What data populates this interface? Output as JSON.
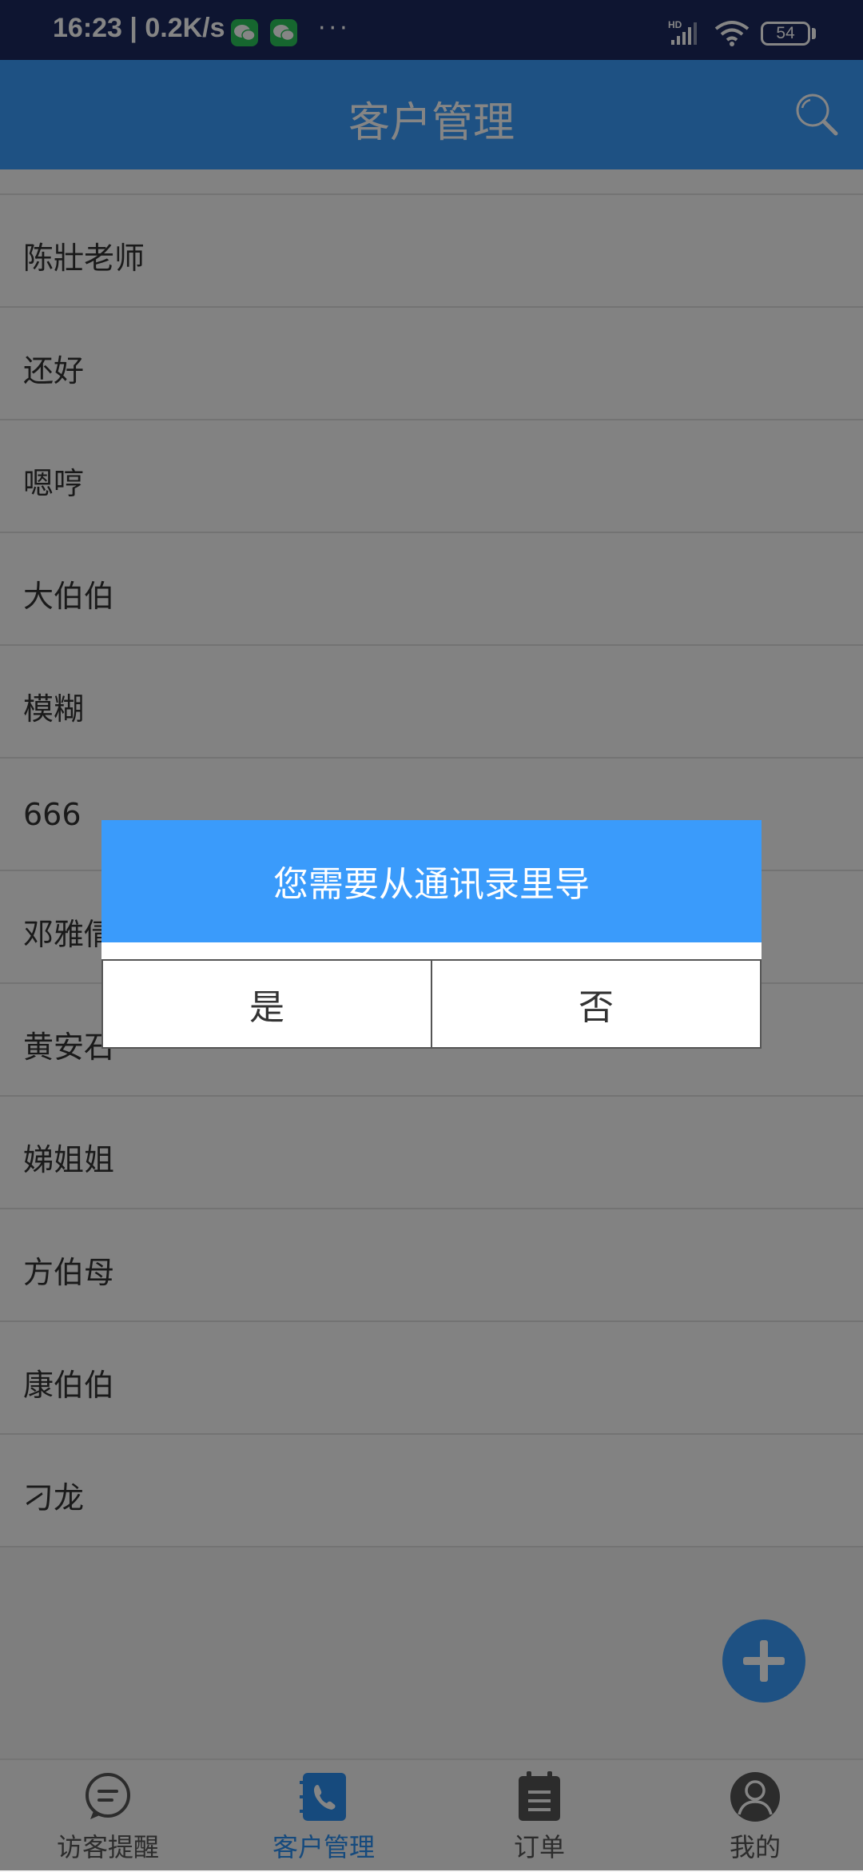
{
  "status_bar": {
    "time_speed": "16:23 | 0.2K/s",
    "dots": "···",
    "network_label": "HD",
    "battery": "54"
  },
  "header": {
    "title": "客户管理"
  },
  "customers": [
    "陈壯老师",
    "还好",
    "嗯哼",
    "大伯伯",
    "模糊",
    "666",
    "邓雅倩",
    "黄安石",
    "娣姐姐",
    "方伯母",
    "康伯伯",
    "刁龙"
  ],
  "bottom_nav": {
    "items": [
      {
        "label": "访客提醒",
        "icon": "chat-icon"
      },
      {
        "label": "客户管理",
        "icon": "phone-book-icon",
        "active": true
      },
      {
        "label": "订单",
        "icon": "clipboard-icon"
      },
      {
        "label": "我的",
        "icon": "user-icon"
      }
    ]
  },
  "dialog": {
    "message": "您需要从通讯录里导",
    "yes_label": "是",
    "no_label": "否"
  },
  "colors": {
    "accent": "#3a9bfb",
    "status_bar": "#1b2a5e"
  }
}
